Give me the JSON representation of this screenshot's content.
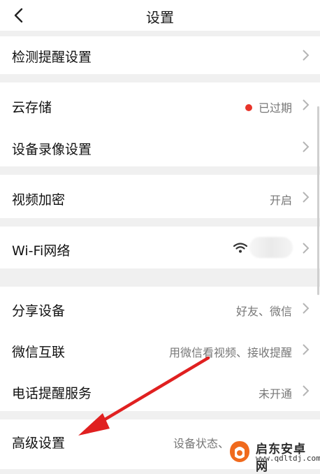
{
  "header": {
    "title": "设置",
    "back_icon": "chevron-left-icon"
  },
  "rows": {
    "detect_reminder": {
      "label": "检测提醒设置"
    },
    "cloud_storage": {
      "label": "云存储",
      "value": "已过期",
      "status_color": "#e8342a"
    },
    "device_recording": {
      "label": "设备录像设置"
    },
    "video_encryption": {
      "label": "视频加密",
      "value": "开启"
    },
    "wifi_network": {
      "label": "Wi-Fi网络",
      "icon": "wifi-icon"
    },
    "share_device": {
      "label": "分享设备",
      "value": "好友、微信"
    },
    "wechat_link": {
      "label": "微信互联",
      "value": "用微信看视频、接收提醒"
    },
    "phone_reminder": {
      "label": "电话提醒服务",
      "value": "未开通"
    },
    "advanced": {
      "label": "高级设置",
      "value": "设备状态、"
    }
  },
  "annotation": {
    "arrow_color": "#e02020"
  },
  "watermark": {
    "name": "启东安卓网",
    "url": "www.qdltdj.com"
  }
}
